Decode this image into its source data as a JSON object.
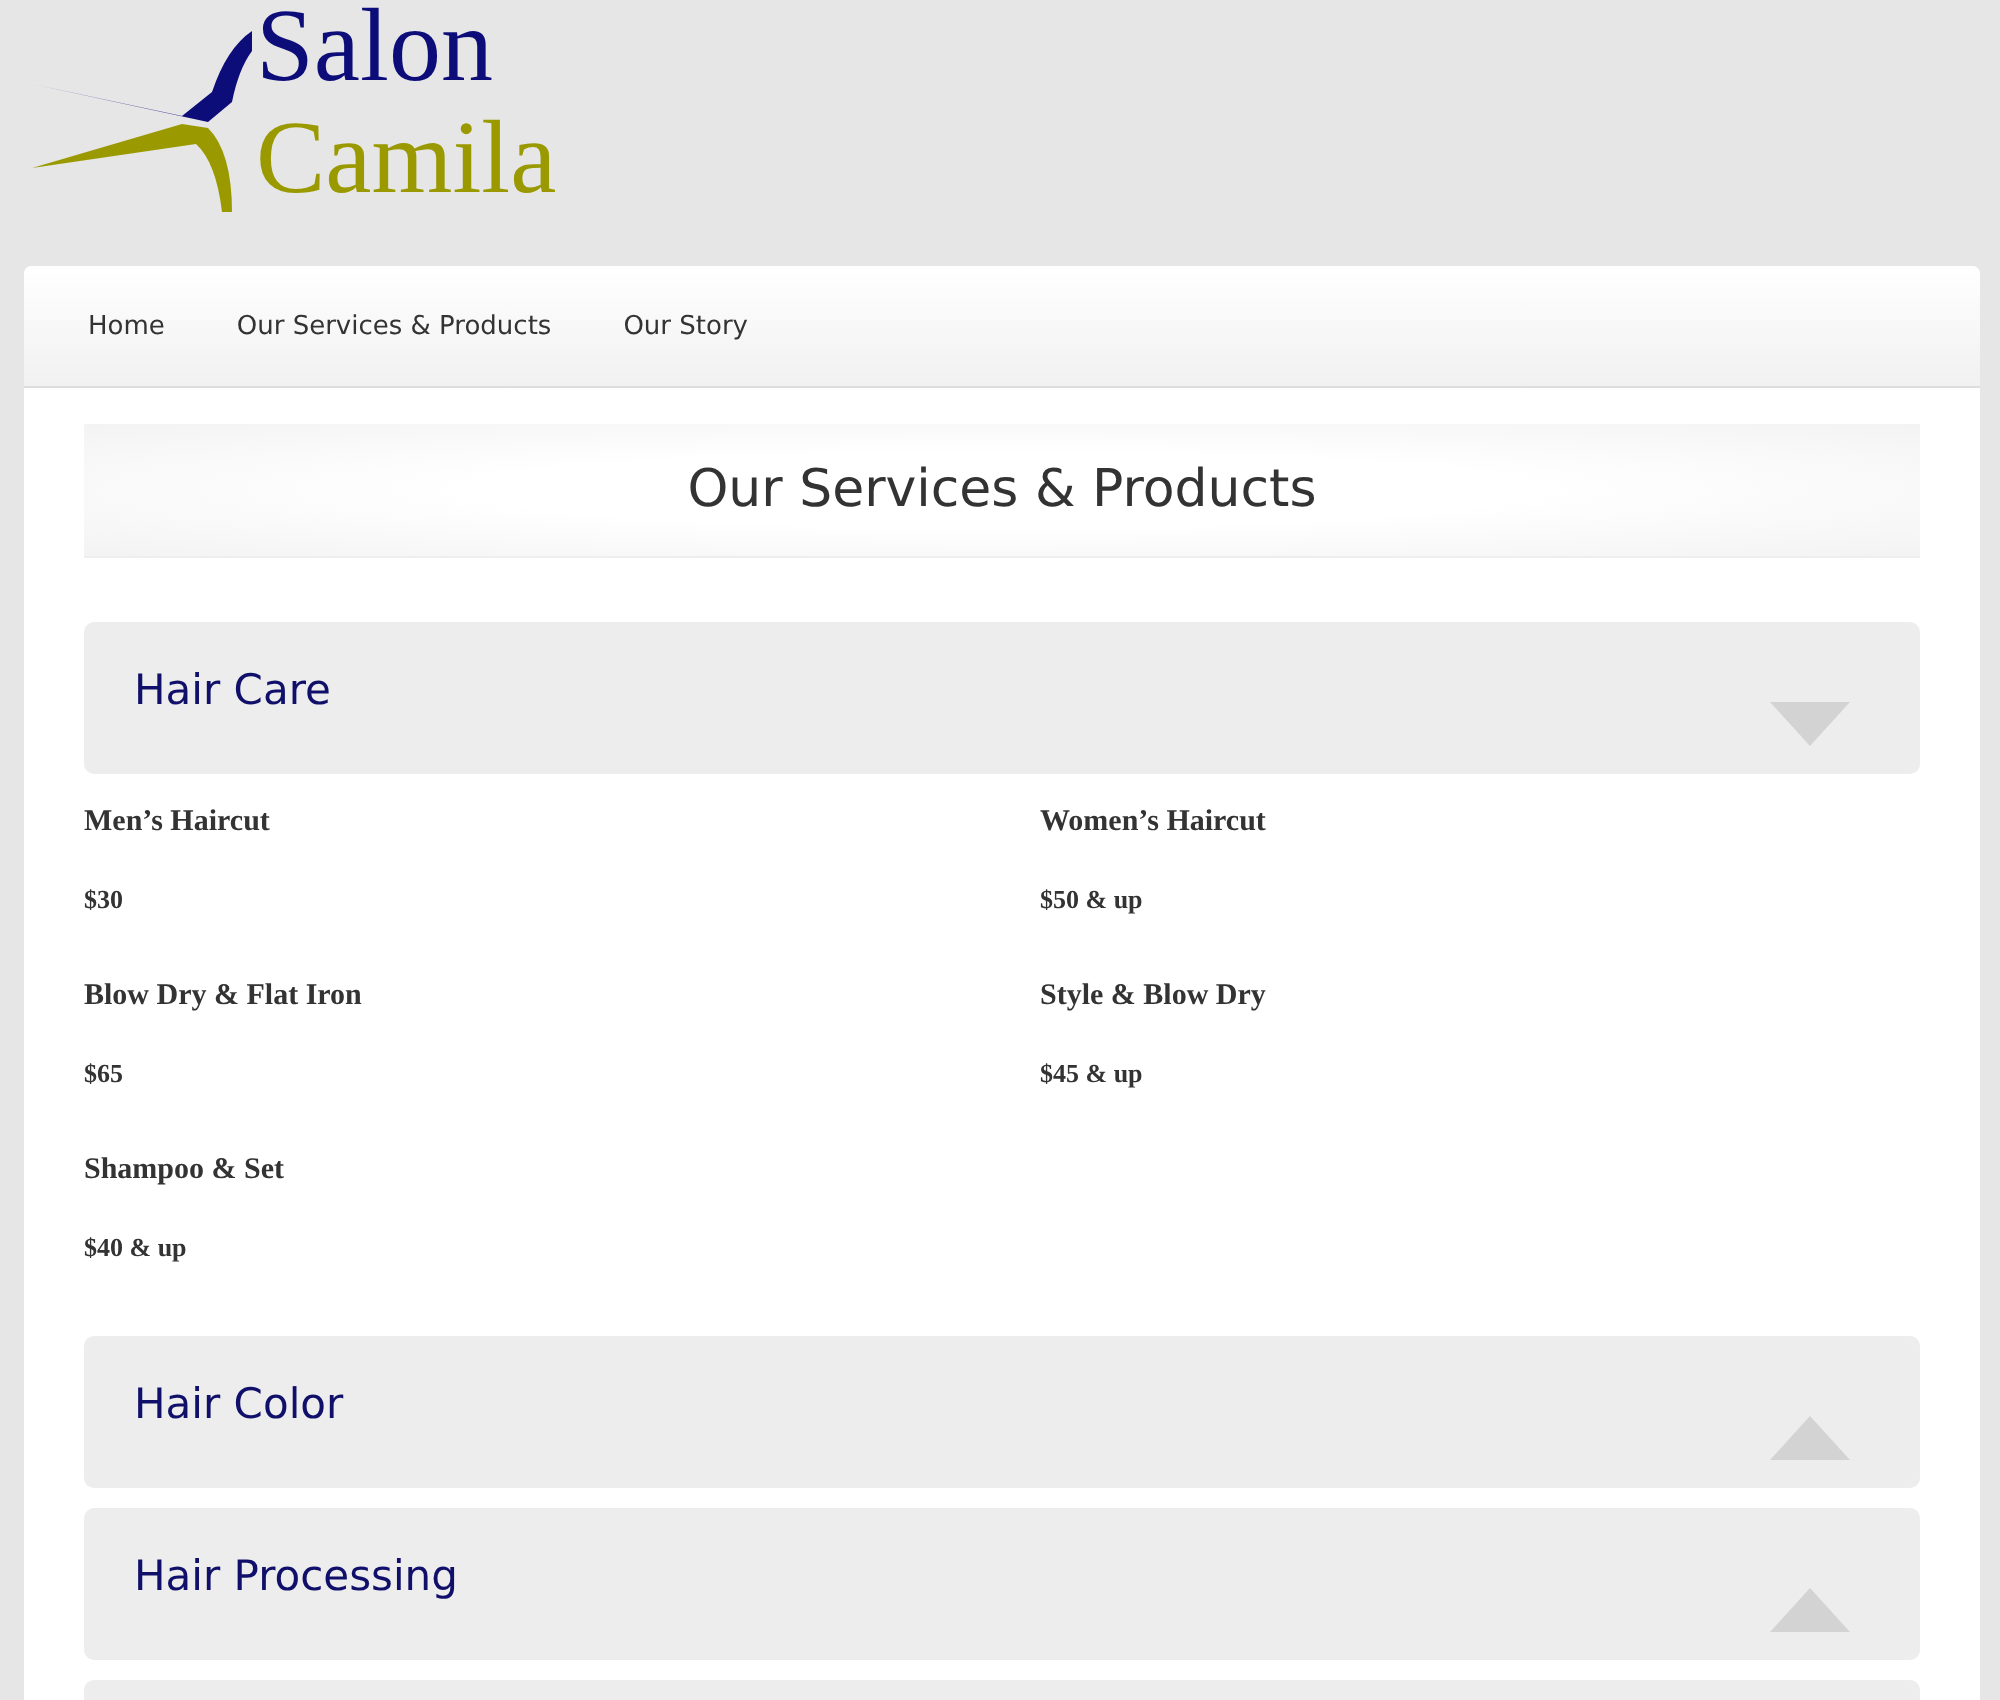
{
  "logo": {
    "line_1": "Salon",
    "line_2": "Camila"
  },
  "nav": [
    {
      "label": "Home"
    },
    {
      "label": "Our Services & Products"
    },
    {
      "label": "Our Story"
    }
  ],
  "page_title": "Our Services & Products",
  "sections": [
    {
      "title": "Hair Care",
      "expanded": true,
      "items": [
        {
          "name": "Men’s Haircut",
          "price": "$30"
        },
        {
          "name": "Women’s Haircut",
          "price": "$50 & up"
        },
        {
          "name": "Blow Dry & Flat Iron",
          "price": "$65"
        },
        {
          "name": "Style & Blow Dry",
          "price": "$45 & up"
        },
        {
          "name": "Shampoo & Set",
          "price": "$40 & up"
        }
      ]
    },
    {
      "title": "Hair Color",
      "expanded": false
    },
    {
      "title": "Hair Processing",
      "expanded": false
    }
  ]
}
